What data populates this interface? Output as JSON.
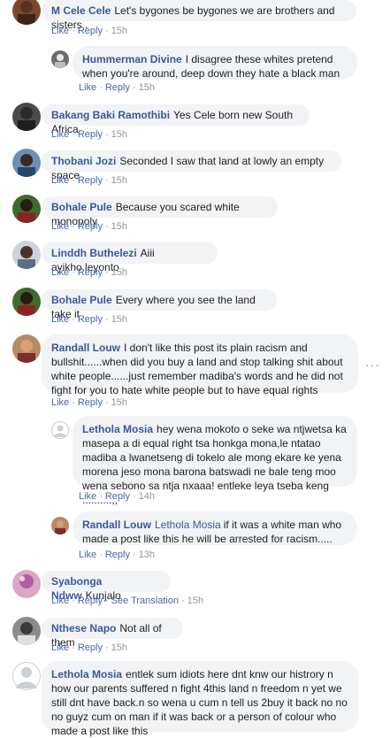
{
  "comments": [
    {
      "author": "M Cele Cele",
      "text": "Let's bygones be bygones we are brothers and sisters .",
      "time": "15h"
    },
    {
      "author": "Hummerman Divine",
      "text": "I disagree these whites pretend when you're around, deep down they hate a black man",
      "time": "15h"
    },
    {
      "author": "Bakang Baki Ramothibi",
      "text": "Yes Cele born new South Africa",
      "time": "15h"
    },
    {
      "author": "Thobani Jozi",
      "text": "Seconded I saw that land at lowly an empty space",
      "time": "15h"
    },
    {
      "author": "Bohale Pule",
      "text": "Because you scared white monopoly",
      "time": "15h"
    },
    {
      "author": "Linddh Buthelezi",
      "text": "Aiii ayikho.leyonto",
      "time": "15h"
    },
    {
      "author": "Bohale Pule",
      "text": "Every where you see the land take it",
      "time": "15h"
    },
    {
      "author": "Randall Louw",
      "text": "I don't like this post its plain racism and bullshit......when did you buy a land and stop talking shit about white people......just remember madiba's words and he did not fight for you to hate white people but to have equal rights",
      "time": "15h"
    },
    {
      "author": "Lethola Mosia",
      "text": "hey wena mokoto o seke wa ntjwetsa ka masepa a di equal right tsa honkga mona,le ntatao madiba a lwanetseng di tokelo ale mong ekare ke yena morena jeso mona barona batswadi ne bale teng moo wena sebono sa ntja nxaaa! entleke leya tseba keng ..........,,",
      "time": "14h"
    },
    {
      "author": "Randall Louw",
      "mention": "Lethola Mosia",
      "text": "if it was a white man who made a post like this he will be arrested for racism.....",
      "time": "13h"
    },
    {
      "author": "Syabonga Ndww",
      "text": "Kunjalo",
      "time": "15h",
      "see_translation": "See Translation"
    },
    {
      "author": "Nthese Napo",
      "text": "Not all of them",
      "time": "15h"
    },
    {
      "author": "Lethola Mosia",
      "text": "entlek sum idiots here dnt knw our histrory n how our parents suffered n fight 4this land n freedom n yet we still dnt have back.n so wena u cum n tell us 2buy it back no no no guyz cum on man if it was back or a person of colour who made a post like this",
      "time": ""
    }
  ],
  "actions": {
    "like": "Like",
    "reply": "Reply",
    "dot": "·"
  },
  "more_icon": "···"
}
